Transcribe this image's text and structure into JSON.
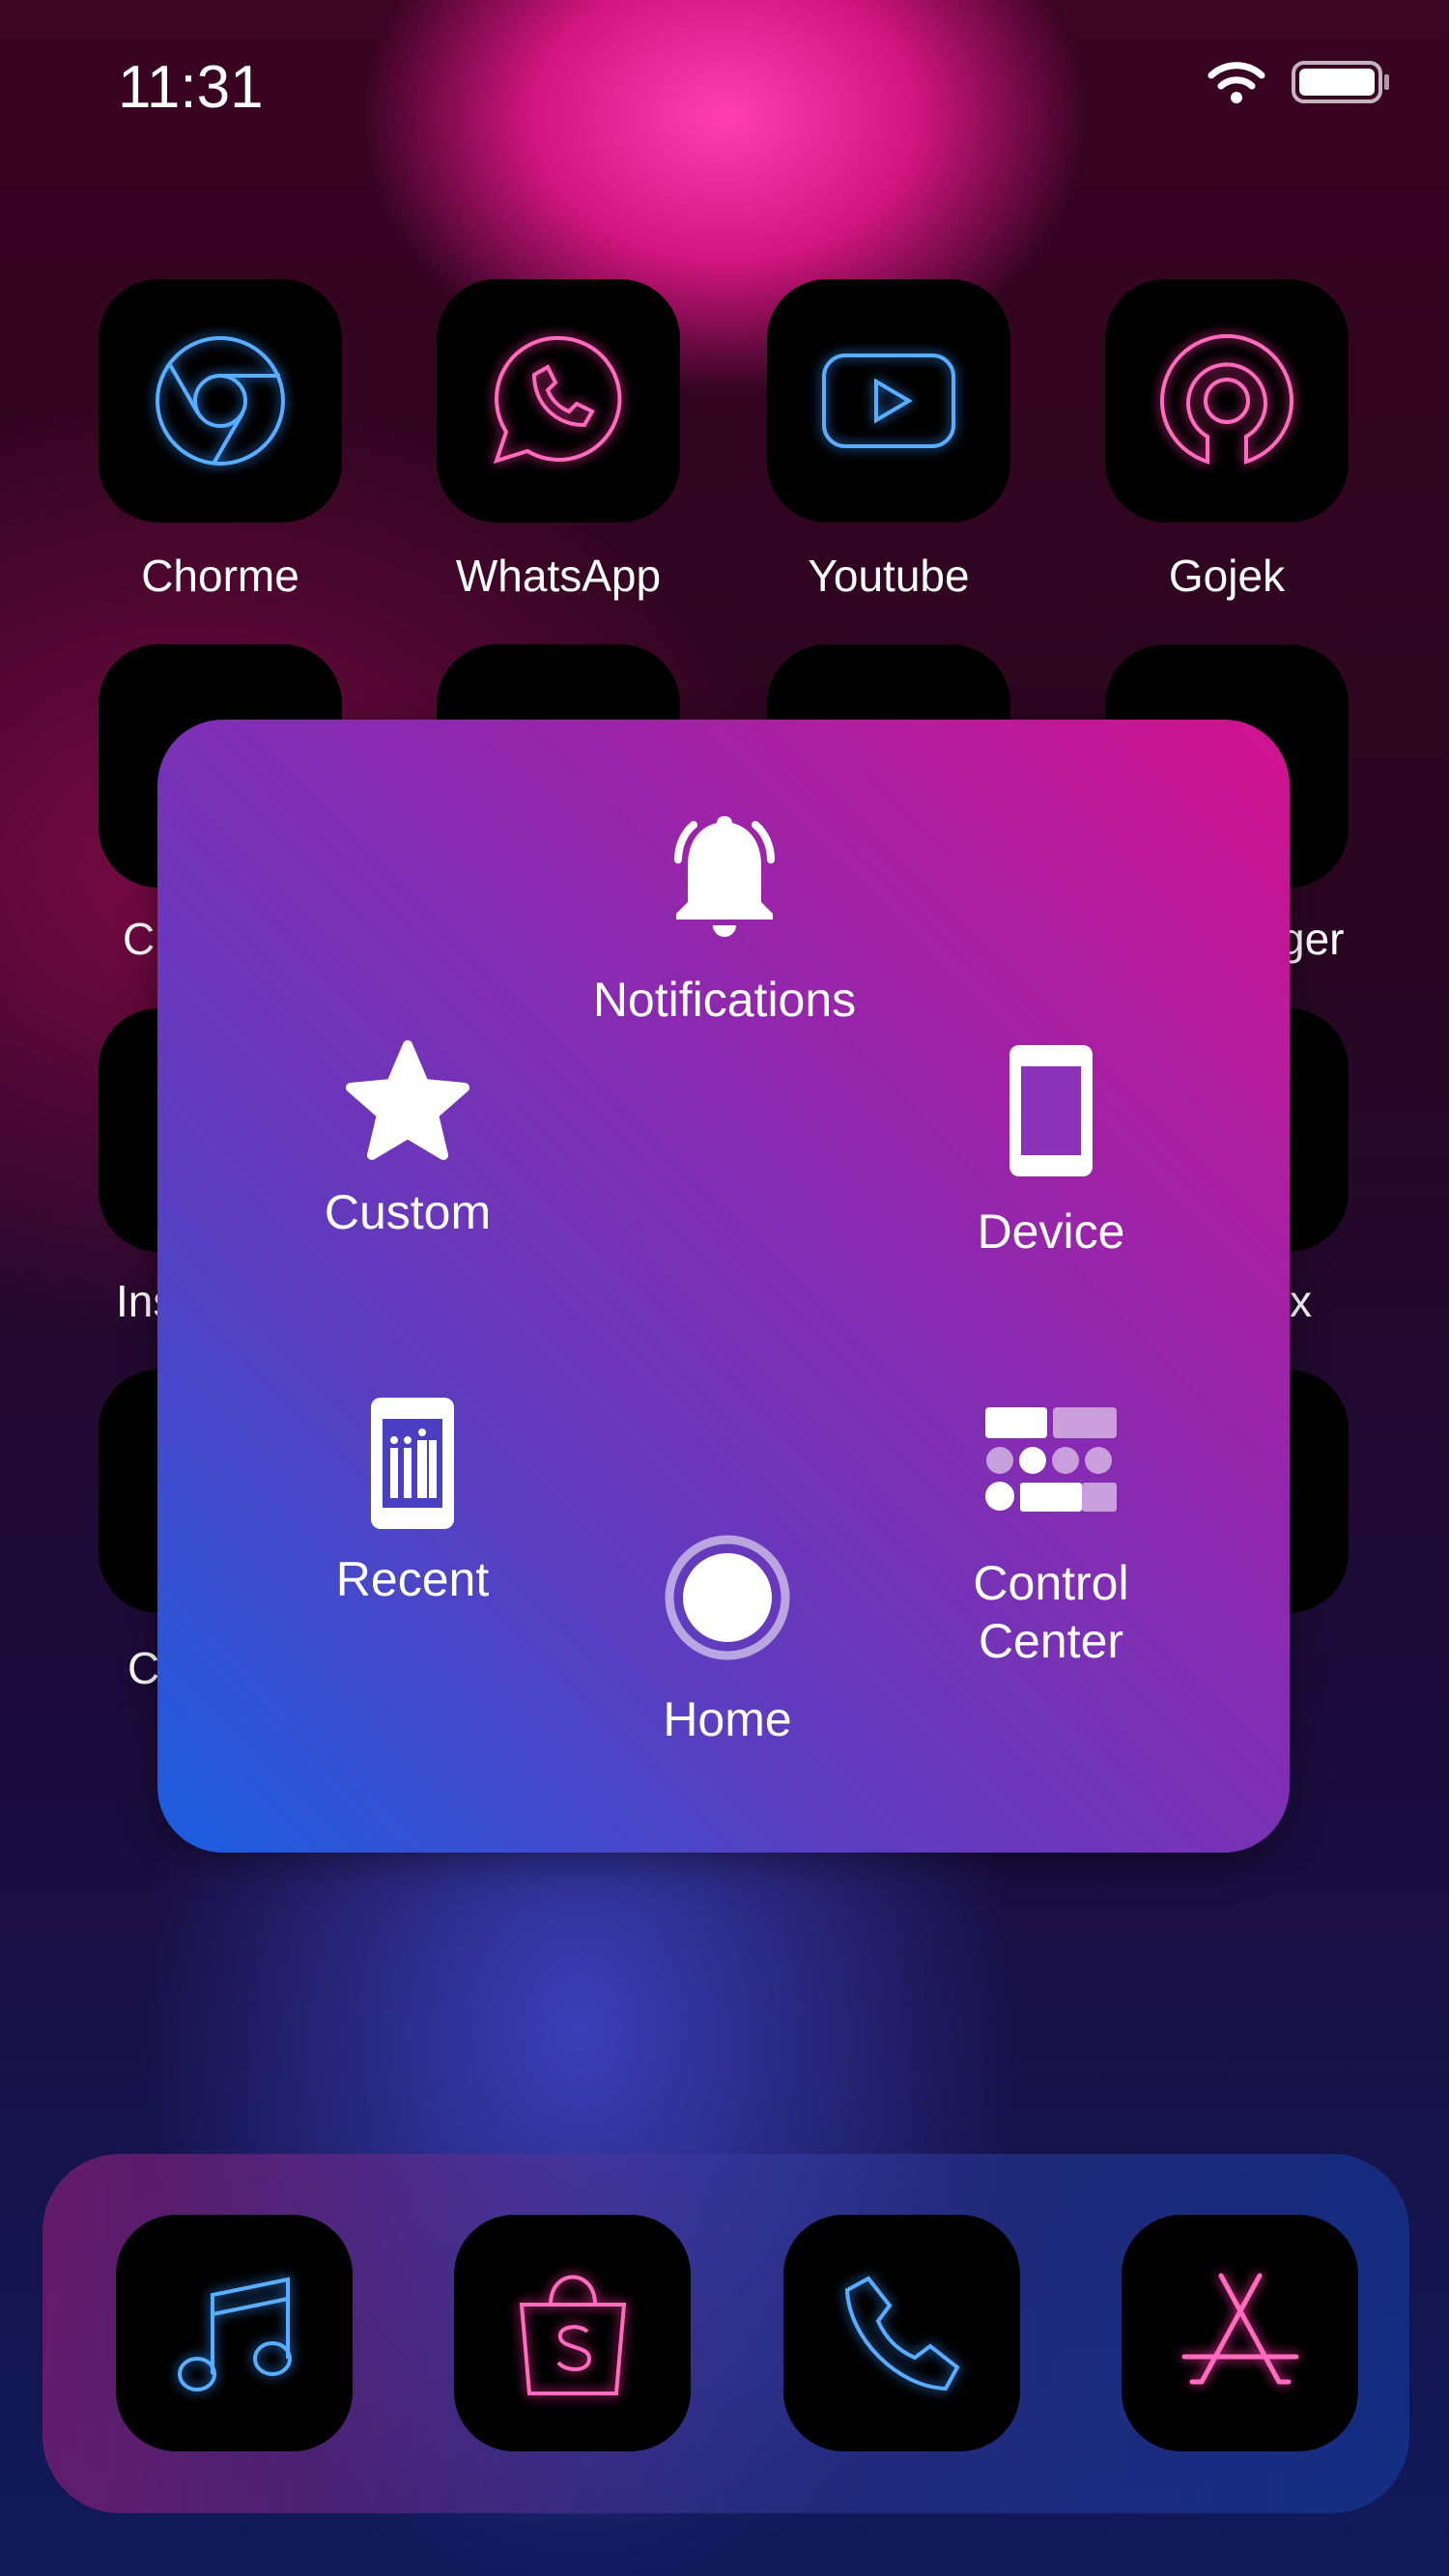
{
  "status_bar": {
    "time": "11:31",
    "icons": [
      "wifi-icon",
      "battery-icon"
    ]
  },
  "apps": [
    {
      "label": "Chorme",
      "icon": "chrome-icon",
      "color": "#3d9bff"
    },
    {
      "label": "WhatsApp",
      "icon": "whatsapp-icon",
      "color": "#ff4fae"
    },
    {
      "label": "Youtube",
      "icon": "youtube-icon",
      "color": "#3d9bff"
    },
    {
      "label": "Gojek",
      "icon": "gojek-icon",
      "color": "#ff4fae"
    }
  ],
  "hidden_label_fragments": {
    "r2c1": "C",
    "r2c4": "ger",
    "r3c1": "Ins",
    "r3c4": "x",
    "r4c1": "C"
  },
  "assistive_menu": {
    "notifications": "Notifications",
    "custom": "Custom",
    "device": "Device",
    "recent": "Recent",
    "control_center_line1": "Control",
    "control_center_line2": "Center",
    "home": "Home"
  },
  "dock": [
    {
      "icon": "music-icon",
      "color": "#3d9bff"
    },
    {
      "icon": "shopee-icon",
      "color": "#ff4fae"
    },
    {
      "icon": "phone-icon",
      "color": "#3d9bff"
    },
    {
      "icon": "app-store-icon",
      "color": "#ff4fae"
    }
  ]
}
